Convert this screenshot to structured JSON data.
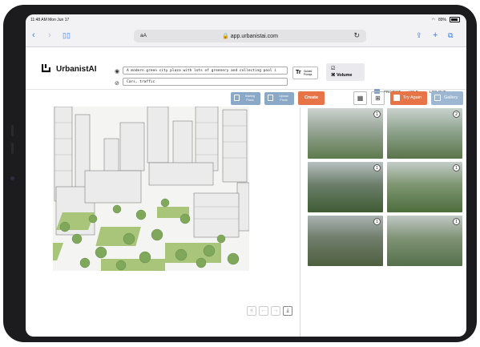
{
  "status_bar": {
    "time": "11:48 AM  Mon Jun 17",
    "battery": "89%"
  },
  "browser": {
    "text_size": "aA",
    "url": "app.urbanistai.com"
  },
  "app": {
    "brand": "UrbanistAI",
    "prompt_value": "A modern green city plaza with lots of greenery and collecting pool i",
    "negative_value": "Cars, traffic",
    "guided_prompt_label": "Guided\nPrompt",
    "volume_label": "Volume",
    "menu": {
      "project": "PROJECT",
      "help": "HELP",
      "logout": "LOG OUT"
    }
  },
  "toolbar": {
    "starting_photo": "Starting Photo",
    "upload_photo": "Upload Photo",
    "create": "Create",
    "try_again": "Try Again",
    "gallery": "Gallery"
  },
  "thumbnails": [
    {
      "count": "1"
    },
    {
      "count": "2"
    },
    {
      "count": "1"
    },
    {
      "count": "1"
    },
    {
      "count": "1"
    },
    {
      "count": "1"
    }
  ],
  "colors": {
    "accent": "#e77447",
    "secondary": "#8aa8c8",
    "ios_blue": "#2f7cf6"
  }
}
